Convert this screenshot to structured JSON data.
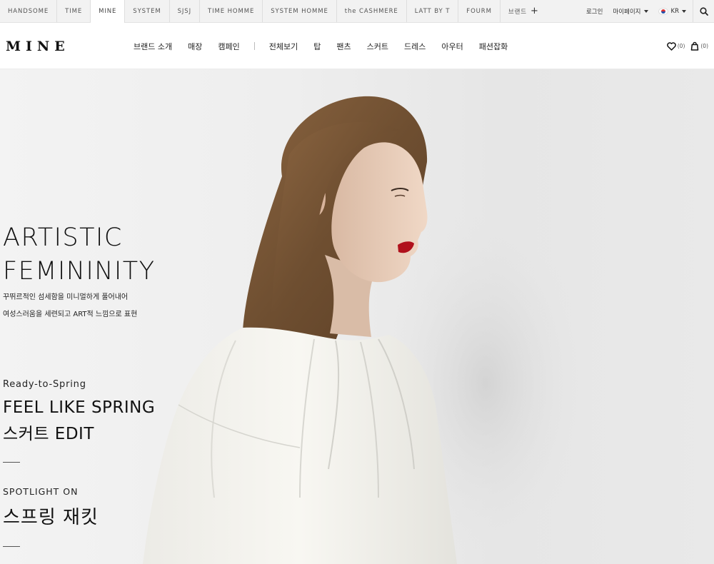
{
  "brand_bar": {
    "brands": [
      {
        "label": "HANDSOME",
        "active": false
      },
      {
        "label": "TIME",
        "active": false
      },
      {
        "label": "MINE",
        "active": true
      },
      {
        "label": "SYSTEM",
        "active": false
      },
      {
        "label": "SJSJ",
        "active": false
      },
      {
        "label": "TIME HOMME",
        "active": false
      },
      {
        "label": "SYSTEM HOMME",
        "active": false
      },
      {
        "label": "the CASHMERE",
        "active": false
      },
      {
        "label": "LATT BY T",
        "active": false
      },
      {
        "label": "FOURM",
        "active": false
      }
    ],
    "more_brands_label": "브랜드",
    "login_label": "로그인",
    "mypage_label": "마이페이지",
    "language_label": "KR"
  },
  "header": {
    "logo": "MINE",
    "primary_nav": [
      "브랜드 소개",
      "매장",
      "캠페인"
    ],
    "category_nav": [
      "전체보기",
      "탑",
      "팬츠",
      "스커트",
      "드레스",
      "아우터",
      "패션잡화"
    ],
    "wishlist_count": "(0)",
    "cart_count": "(0)"
  },
  "hero": {
    "headline_line1": "ARTISTIC",
    "headline_line2": "FEMININITY",
    "desc_line1": "꾸뛰르적인 섬세함을 미니멀하게 풀어내어",
    "desc_line2": "여성스러움을 세련되고 ART적 느낌으로 표현",
    "feature_kicker": "Ready-to-Spring",
    "feature_line1": "FEEL LIKE SPRING",
    "feature_line2": "스커트 EDIT",
    "spotlight_label": "SPOTLIGHT ON",
    "spotlight_title": "스프링 재킷"
  },
  "colors": {
    "accent_lip": "#b0111c",
    "hair": "#7a5635",
    "background": "#ececec"
  }
}
